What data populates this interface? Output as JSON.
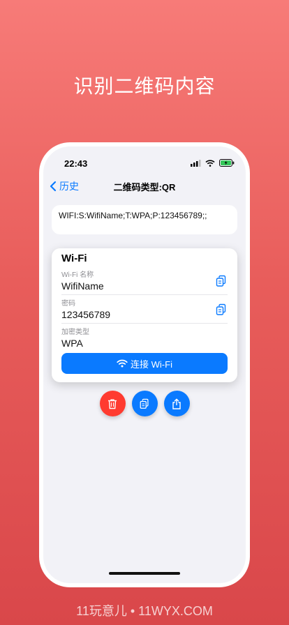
{
  "headline": "识别二维码内容",
  "watermark": "11玩意儿 • 11WYX.COM",
  "status_bar": {
    "time": "22:43"
  },
  "nav": {
    "back_label": "历史",
    "title": "二维码类型:QR"
  },
  "raw_content": "WIFI:S:WifiName;T:WPA;P:123456789;;",
  "wifi_card": {
    "title": "Wi-Fi",
    "fields": [
      {
        "label": "Wi-Fi 名称",
        "value": "WifiName"
      },
      {
        "label": "密码",
        "value": "123456789"
      },
      {
        "label": "加密类型",
        "value": "WPA"
      }
    ],
    "connect_label": "连接 Wi-Fi"
  },
  "actions": [
    {
      "icon": "trash-icon",
      "color": "#ff3b30"
    },
    {
      "icon": "copy-icon",
      "color": "#0a7aff"
    },
    {
      "icon": "share-icon",
      "color": "#0a7aff"
    }
  ],
  "colors": {
    "accent": "#0a7aff",
    "danger": "#ff3b30",
    "background_top": "#f77b78",
    "background_bottom": "#d9474a"
  }
}
